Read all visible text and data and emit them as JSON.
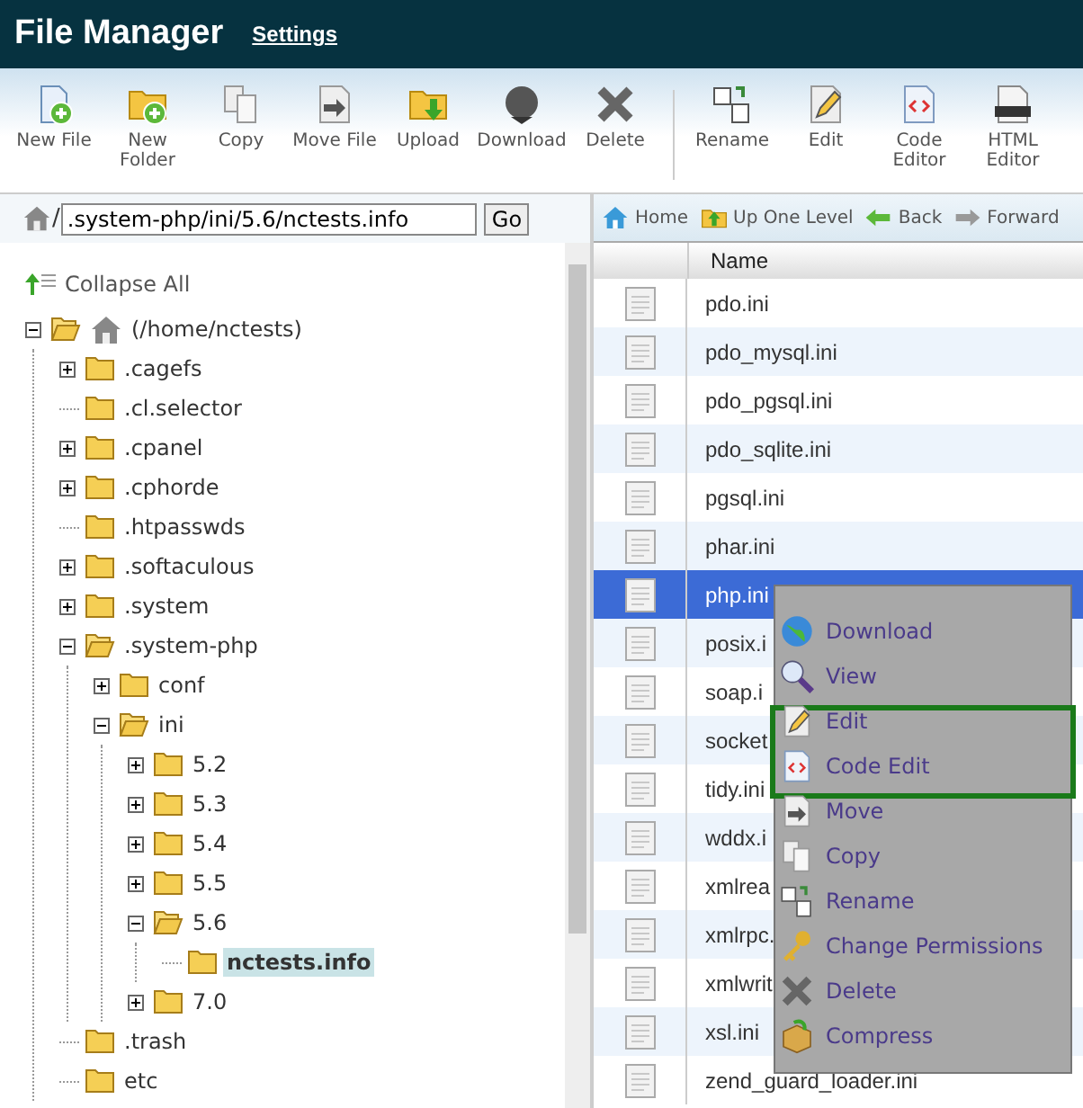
{
  "header": {
    "title": "File Manager",
    "settings_link": "Settings"
  },
  "toolbar": {
    "file_actions": [
      "New File",
      "New Folder",
      "Copy",
      "Move File",
      "Upload",
      "Download",
      "Delete"
    ],
    "editor_actions": [
      "Rename",
      "Edit",
      "Code Editor",
      "HTML Editor"
    ]
  },
  "path_bar": {
    "separator": "/",
    "value": ".system-php/ini/5.6/nctests.info",
    "go_button": "Go"
  },
  "nav": [
    "Home",
    "Up One Level",
    "Back",
    "Forward"
  ],
  "tree": {
    "collapse_all": "Collapse All",
    "root": {
      "label": "(/home/nctests)",
      "expanded": true,
      "has_children": true,
      "selected": false,
      "children": [
        {
          "label": ".cagefs",
          "expanded": false,
          "has_children": true,
          "selected": false
        },
        {
          "label": ".cl.selector",
          "expanded": false,
          "has_children": false,
          "selected": false
        },
        {
          "label": ".cpanel",
          "expanded": false,
          "has_children": true,
          "selected": false
        },
        {
          "label": ".cphorde",
          "expanded": false,
          "has_children": true,
          "selected": false
        },
        {
          "label": ".htpasswds",
          "expanded": false,
          "has_children": false,
          "selected": false
        },
        {
          "label": ".softaculous",
          "expanded": false,
          "has_children": true,
          "selected": false
        },
        {
          "label": ".system",
          "expanded": false,
          "has_children": true,
          "selected": false
        },
        {
          "label": ".system-php",
          "expanded": true,
          "has_children": true,
          "selected": false,
          "children": [
            {
              "label": "conf",
              "expanded": false,
              "has_children": true,
              "selected": false
            },
            {
              "label": "ini",
              "expanded": true,
              "has_children": true,
              "selected": false,
              "children": [
                {
                  "label": "5.2",
                  "expanded": false,
                  "has_children": true,
                  "selected": false
                },
                {
                  "label": "5.3",
                  "expanded": false,
                  "has_children": true,
                  "selected": false
                },
                {
                  "label": "5.4",
                  "expanded": false,
                  "has_children": true,
                  "selected": false
                },
                {
                  "label": "5.5",
                  "expanded": false,
                  "has_children": true,
                  "selected": false
                },
                {
                  "label": "5.6",
                  "expanded": true,
                  "has_children": true,
                  "selected": false,
                  "children": [
                    {
                      "label": "nctests.info",
                      "expanded": false,
                      "has_children": false,
                      "selected": true
                    }
                  ]
                },
                {
                  "label": "7.0",
                  "expanded": false,
                  "has_children": true,
                  "selected": false
                }
              ]
            }
          ]
        },
        {
          "label": ".trash",
          "expanded": false,
          "has_children": false,
          "selected": false
        },
        {
          "label": "etc",
          "expanded": false,
          "has_children": false,
          "selected": false
        }
      ]
    }
  },
  "table": {
    "columns": [
      "Name"
    ],
    "rows": [
      {
        "name": "pdo.ini",
        "selected": false
      },
      {
        "name": "pdo_mysql.ini",
        "selected": false
      },
      {
        "name": "pdo_pgsql.ini",
        "selected": false
      },
      {
        "name": "pdo_sqlite.ini",
        "selected": false
      },
      {
        "name": "pgsql.ini",
        "selected": false
      },
      {
        "name": "phar.ini",
        "selected": false
      },
      {
        "name": "php.ini",
        "selected": true
      },
      {
        "name": "posix.i",
        "selected": false
      },
      {
        "name": "soap.i",
        "selected": false
      },
      {
        "name": "socket",
        "selected": false
      },
      {
        "name": "tidy.ini",
        "selected": false
      },
      {
        "name": "wddx.i",
        "selected": false
      },
      {
        "name": "xmlrea",
        "selected": false
      },
      {
        "name": "xmlrpc.",
        "selected": false
      },
      {
        "name": "xmlwrit",
        "selected": false
      },
      {
        "name": "xsl.ini",
        "selected": false
      },
      {
        "name": "zend_guard_loader.ini",
        "selected": false
      }
    ]
  },
  "context_menu": {
    "items": [
      {
        "label": "Download",
        "highlighted": false
      },
      {
        "label": "View",
        "highlighted": false
      },
      {
        "label": "Edit",
        "highlighted": true
      },
      {
        "label": "Code Edit",
        "highlighted": true
      },
      {
        "label": "Move",
        "highlighted": false
      },
      {
        "label": "Copy",
        "highlighted": false
      },
      {
        "label": "Rename",
        "highlighted": false
      },
      {
        "label": "Change Permissions",
        "highlighted": false
      },
      {
        "label": "Delete",
        "highlighted": false
      },
      {
        "label": "Compress",
        "highlighted": false
      }
    ]
  }
}
